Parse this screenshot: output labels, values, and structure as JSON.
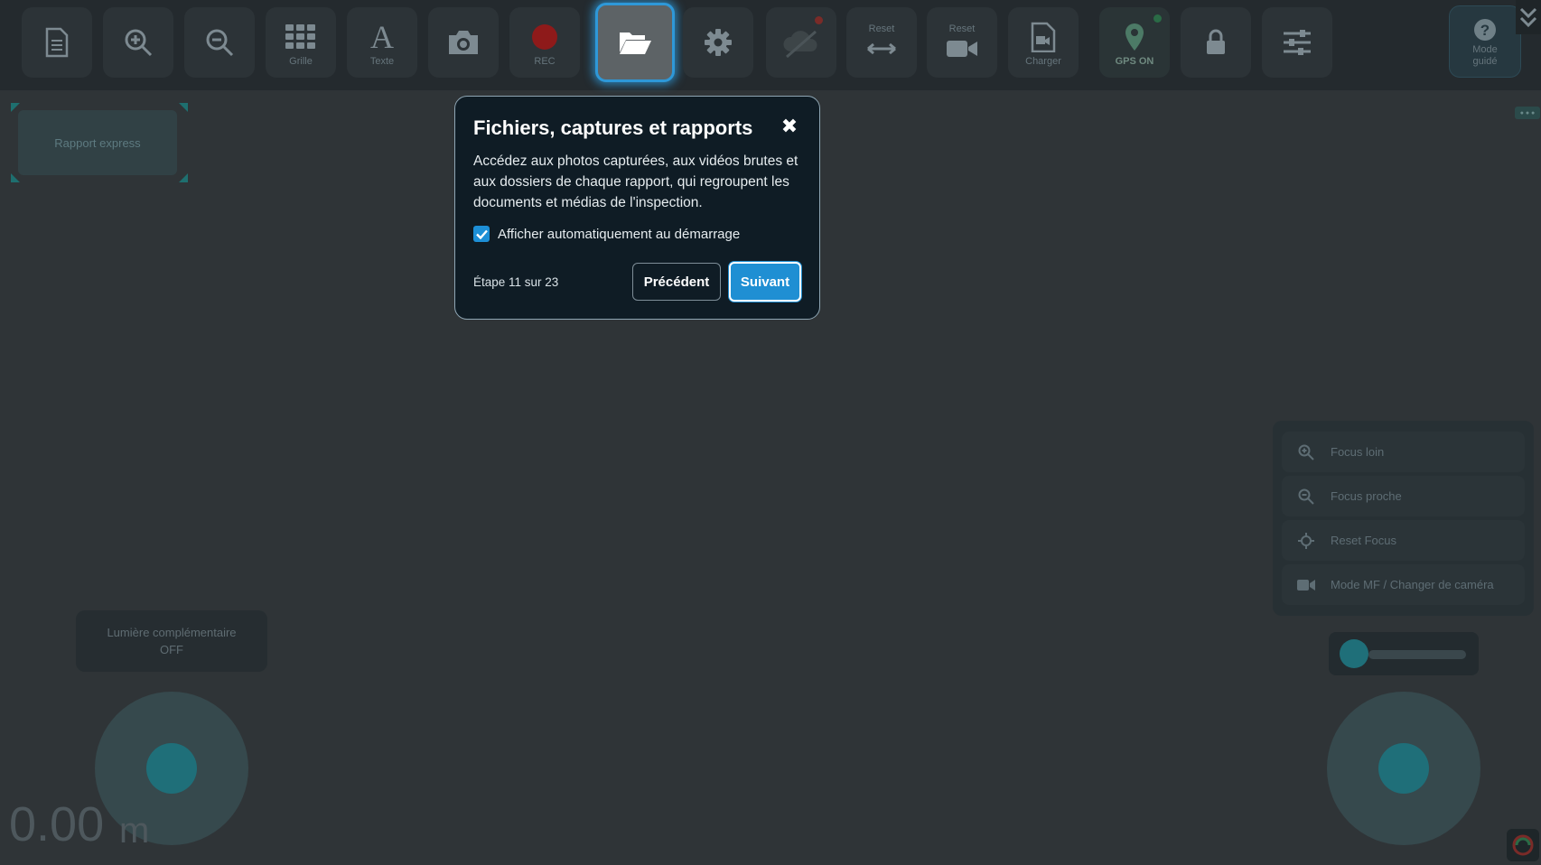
{
  "toolbar": {
    "buttons": [
      {
        "name": "document-button",
        "icon": "document-icon",
        "label": ""
      },
      {
        "name": "zoom-in-button",
        "icon": "zoom-in-icon",
        "label": ""
      },
      {
        "name": "zoom-out-button",
        "icon": "zoom-out-icon",
        "label": ""
      },
      {
        "name": "grid-button",
        "icon": "grid-icon",
        "label": "Grille"
      },
      {
        "name": "text-button",
        "icon": "text-icon",
        "label": "Texte"
      },
      {
        "name": "camera-button",
        "icon": "camera-icon",
        "label": ""
      },
      {
        "name": "rec-button",
        "icon": "record-icon",
        "label": "REC"
      },
      {
        "name": "files-button",
        "icon": "folder-open-icon",
        "label": ""
      },
      {
        "name": "settings-button",
        "icon": "gear-icon",
        "label": ""
      },
      {
        "name": "cloud-button",
        "icon": "cloud-off-icon",
        "label": ""
      },
      {
        "name": "reset-position-button",
        "icon": "horizontal-arrows-icon",
        "top_label": "Reset"
      },
      {
        "name": "reset-camera-button",
        "icon": "video-camera-icon",
        "top_label": "Reset"
      },
      {
        "name": "charger-button",
        "icon": "file-video-icon",
        "label": "Charger"
      },
      {
        "name": "gps-button",
        "icon": "map-pin-icon",
        "label": "GPS ON"
      },
      {
        "name": "lock-button",
        "icon": "lock-icon",
        "label": ""
      },
      {
        "name": "sliders-button",
        "icon": "sliders-icon",
        "label": ""
      },
      {
        "name": "guided-mode-button",
        "icon": "question-icon",
        "label": "Mode guidé"
      }
    ],
    "labels": {
      "grille": "Grille",
      "texte": "Texte",
      "rec": "REC",
      "reset1": "Reset",
      "reset2": "Reset",
      "charger": "Charger",
      "gps": "GPS ON",
      "mode": "Mode",
      "guide": "guidé"
    },
    "colors": {
      "active_border": "#2e98d8",
      "rec_dot": "#c0392b",
      "gps_dot": "#2e9c5a"
    }
  },
  "rapport_express": {
    "label": "Rapport express"
  },
  "popover": {
    "title": "Fichiers, captures et rapports",
    "body": "Accédez aux photos capturées, aux vidéos brutes et aux dossiers de chaque rapport, qui regroupent les documents et médias de l'inspection.",
    "checkbox_label": "Afficher automatiquement au démarrage",
    "checkbox_checked": true,
    "step_text": "Étape 11 sur 23",
    "prev_label": "Précédent",
    "next_label": "Suivant",
    "close_icon": "close-icon"
  },
  "lumiere": {
    "line1": "Lumière complémentaire",
    "line2": "OFF"
  },
  "speed": {
    "value": "0.00",
    "unit": "m"
  },
  "focus_panel": {
    "items": [
      {
        "label": "Focus loin",
        "icon": "zoom-in-icon"
      },
      {
        "label": "Focus proche",
        "icon": "zoom-out-icon"
      },
      {
        "label": "Reset Focus",
        "icon": "crosshair-icon"
      },
      {
        "label": "Mode MF / Changer de caméra",
        "icon": "video-camera-icon"
      }
    ]
  }
}
